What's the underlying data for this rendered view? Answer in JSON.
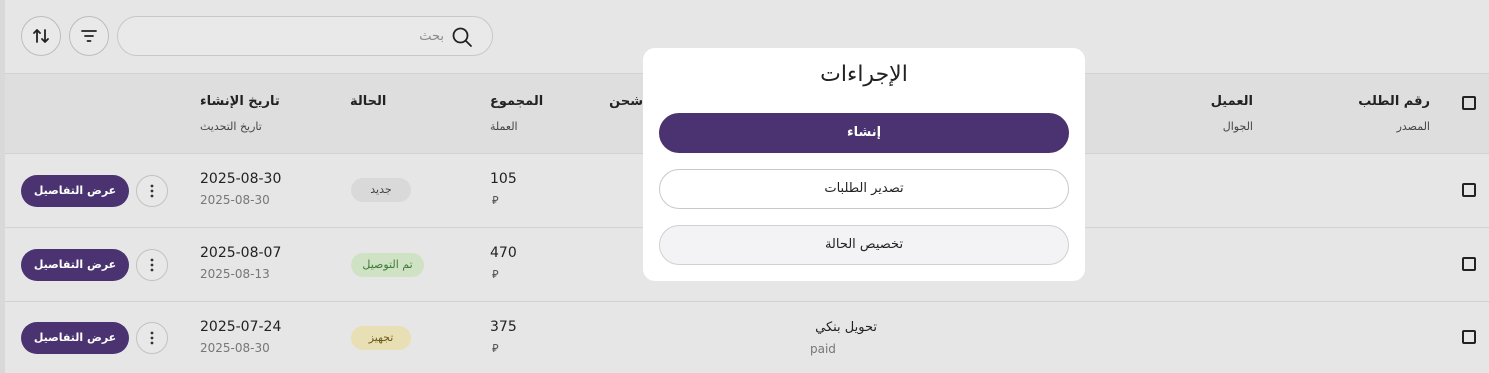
{
  "toolbar": {
    "search_placeholder": "بحث",
    "sort_icon": "sort-arrows-icon",
    "filter_icon": "filter-lines-icon"
  },
  "table": {
    "headers": {
      "order_number": "رقم الطلب",
      "source": "المصدر",
      "customer": "العميل",
      "phone": "الجوال",
      "shipping_partial": "شحن",
      "total": "المجموع",
      "currency": "العملة",
      "status": "الحالة",
      "created_at": "تاريخ الإنشاء",
      "updated_at": "تاريخ التحديث"
    },
    "rows": [
      {
        "created": "2025-08-30",
        "updated": "2025-08-30",
        "total": "105",
        "currency_symbol": "⃁",
        "status": "جديد",
        "payment_method": "",
        "payment_status": "",
        "details_label": "عرض التفاصيل"
      },
      {
        "created": "2025-08-07",
        "updated": "2025-08-13",
        "total": "470",
        "currency_symbol": "⃁",
        "status": "تم التوصيل",
        "payment_method": "",
        "payment_status": "",
        "details_label": "عرض التفاصيل"
      },
      {
        "created": "2025-07-24",
        "updated": "2025-08-30",
        "total": "375",
        "currency_symbol": "⃁",
        "status": "تجهيز",
        "payment_method": "تحويل بنكي",
        "payment_status": "paid",
        "details_label": "عرض التفاصيل"
      }
    ]
  },
  "modal": {
    "title": "الإجراءات",
    "create_label": "إنشاء",
    "export_label": "تصدير الطلبات",
    "customize_label": "تخصيص الحالة"
  },
  "colors": {
    "primary": "#4a3370",
    "badge_new_bg": "#d9d9d9",
    "badge_delivered_bg": "#cfe3c4",
    "badge_delivered_text": "#3f7a3a",
    "badge_processing_bg": "#e8dfb4",
    "badge_processing_text": "#6b5a1a"
  }
}
